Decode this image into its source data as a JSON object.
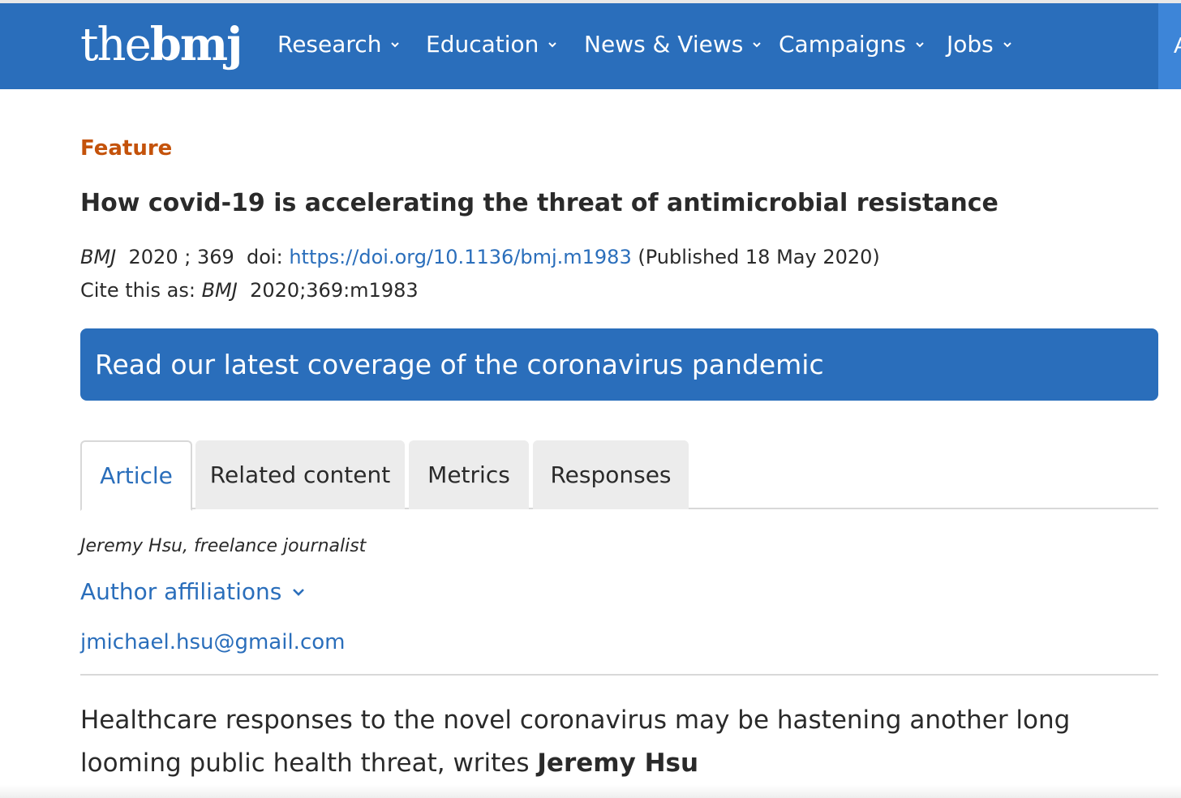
{
  "nav": {
    "logo_the": "the",
    "logo_bmj": "bmj",
    "items": [
      {
        "label": "Research"
      },
      {
        "label": "Education"
      },
      {
        "label": "News & Views"
      },
      {
        "label": "Campaigns"
      },
      {
        "label": "Jobs"
      }
    ],
    "overflow_label": "A"
  },
  "article": {
    "type": "Feature",
    "title": "How covid-19 is accelerating the threat of antimicrobial resistance",
    "journal": "BMJ",
    "year_volume": "2020 ; 369",
    "doi_label": "doi:",
    "doi_url": "https://doi.org/10.1136/bmj.m1983",
    "published": "(Published 18 May 2020)",
    "cite_prefix": "Cite this as:",
    "cite_journal": "BMJ",
    "cite_ref": "2020;369:m1983"
  },
  "banner": {
    "text": "Read our latest coverage of the coronavirus pandemic"
  },
  "tabs": [
    {
      "label": "Article",
      "active": true
    },
    {
      "label": "Related content",
      "active": false
    },
    {
      "label": "Metrics",
      "active": false
    },
    {
      "label": "Responses",
      "active": false
    }
  ],
  "byline": {
    "author": "Jeremy Hsu, freelance journalist",
    "affiliations_label": "Author affiliations",
    "email": "jmichael.hsu@gmail.com"
  },
  "standfirst": {
    "text": "Healthcare responses to the novel coronavirus may be hastening another long looming public health threat, writes ",
    "author": "Jeremy Hsu"
  },
  "colors": {
    "brand_blue": "#2a6ebb",
    "feature_orange": "#c4520a",
    "tab_grey": "#ececec"
  }
}
